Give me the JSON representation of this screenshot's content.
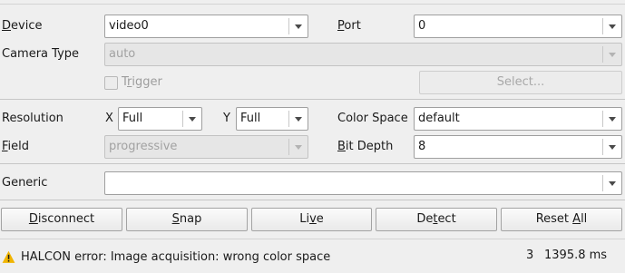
{
  "device": {
    "label_u": "D",
    "label_rest": "evice",
    "value": "video0"
  },
  "port": {
    "label_u": "P",
    "label_rest": "ort",
    "value": "0"
  },
  "camera_type": {
    "label": "Camera Type",
    "value": "auto"
  },
  "trigger": {
    "label_pre": "T",
    "label_u": "r",
    "label_rest": "igger",
    "checked": false
  },
  "select_button": "Select...",
  "resolution": {
    "label": "Resolution",
    "x_label": "X",
    "x_value": "Full",
    "y_label": "Y",
    "y_value": "Full"
  },
  "color_space": {
    "label": "Color Space",
    "value": "default"
  },
  "field": {
    "label_u": "F",
    "label_rest": "ield",
    "value": "progressive"
  },
  "bit_depth": {
    "label_u": "B",
    "label_rest": "it Depth",
    "value": "8"
  },
  "generic": {
    "label": "Generic",
    "value": ""
  },
  "buttons": {
    "disconnect": {
      "u": "D",
      "rest": "isconnect"
    },
    "snap": {
      "u": "S",
      "rest": "nap"
    },
    "live": {
      "pre": "Li",
      "u": "v",
      "rest": "e"
    },
    "detect": {
      "pre": "De",
      "u": "t",
      "rest": "ect"
    },
    "reset_all": {
      "pre": "Reset ",
      "u": "A",
      "rest": "ll"
    }
  },
  "status": {
    "icon": "warning-icon",
    "message": "HALCON error: Image acquisition: wrong color space",
    "count": "3",
    "time": "1395.8 ms",
    "warning_color": "#f0b400"
  }
}
